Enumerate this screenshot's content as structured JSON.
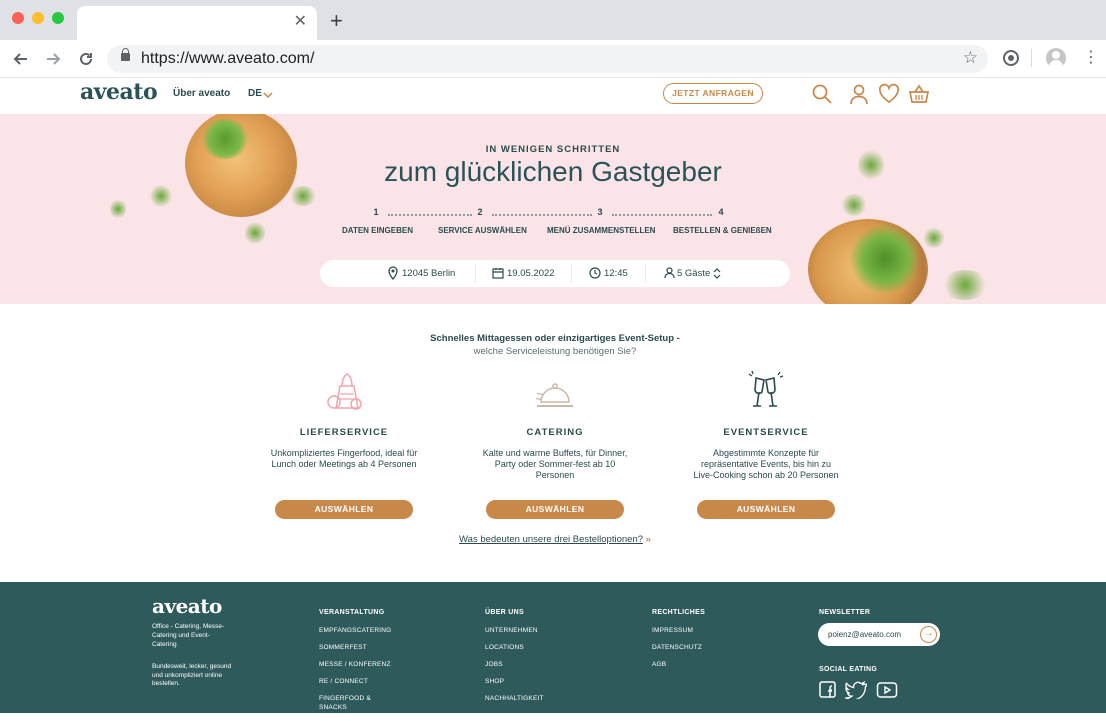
{
  "browser": {
    "tab_close": "✕",
    "new_tab": "+",
    "url": "https://www.aveato.com/"
  },
  "header": {
    "logo": "aveato",
    "nav_about": "Über aveato",
    "lang": "DE",
    "cta": "JETZT ANFRAGEN",
    "icons": [
      "search-icon",
      "user-icon",
      "heart-icon",
      "basket-icon"
    ]
  },
  "hero": {
    "kicker": "IN WENIGEN SCHRITTEN",
    "title": "zum glücklichen Gastgeber",
    "steps": [
      {
        "num": "1",
        "label": "DATEN EINGEBEN"
      },
      {
        "num": "2",
        "label": "SERVICE AUSWÄHLEN"
      },
      {
        "num": "3",
        "label": "MENÜ ZUSAMMENSTELLEN"
      },
      {
        "num": "4",
        "label": "BESTELLEN & GENIEßEN"
      }
    ],
    "search": {
      "location": "12045 Berlin",
      "date": "19.05.2022",
      "time": "12:45",
      "guests": "5 Gäste"
    }
  },
  "services": {
    "intro_line1": "Schnelles Mittagessen oder einzigartiges Event-Setup -",
    "intro_line2": "welche Serviceleistung benötigen Sie?",
    "items": [
      {
        "title": "LIEFERSERVICE",
        "desc": "Unkompliziertes Fingerfood, ideal für Lunch oder Meetings ab 4 Personen",
        "button": "AUSWÄHLEN",
        "icon": "delivery-icon"
      },
      {
        "title": "CATERING",
        "desc": "Kalte und warme Buffets, für Dinner, Party oder Sommer-fest ab 10 Personen",
        "button": "AUSWÄHLEN",
        "icon": "cloche-icon"
      },
      {
        "title": "EVENTSERVICE",
        "desc": "Abgestimmte Konzepte für repräsentative Events, bis hin zu Live-Cooking schon ab 20 Personen",
        "button": "AUSWÄHLEN",
        "icon": "champagne-icon"
      }
    ],
    "order_link": "Was bedeuten unsere drei Bestelloptionen?",
    "order_link_arrow": "»"
  },
  "footer": {
    "logo": "aveato",
    "tagline": "Office - Catering, Messe- Catering und Event-Catering",
    "claim": "Bundesweit, lecker, gesund und unkompliziert online bestellen.",
    "columns": [
      {
        "title": "VERANSTALTUNG",
        "links": [
          "EMPFANGSCATERING",
          "SOMMERFEST",
          "MESSE / KONFERENZ",
          "RE / CONNECT",
          "FINGERFOOD &",
          "SNACKS"
        ]
      },
      {
        "title": "ÜBER UNS",
        "links": [
          "UNTERNEHMEN",
          "LOCATIONS",
          "JOBS",
          "SHOP",
          "NACHHALTIGKEIT"
        ]
      },
      {
        "title": "RECHTLICHES",
        "links": [
          "IMPRESSUM",
          "DATENSCHUTZ",
          "AGB"
        ]
      }
    ],
    "newsletter_title": "NEWSLETTER",
    "newsletter_value": "poienz@aveato.com",
    "newsletter_submit": "→",
    "social_title": "SOCIAL EATING",
    "social_icons": [
      "facebook-icon",
      "twitter-icon",
      "youtube-icon"
    ]
  },
  "colors": {
    "accent": "#c8884a",
    "teal": "#2e5a5c",
    "hero_bg": "#fbe4e7"
  }
}
